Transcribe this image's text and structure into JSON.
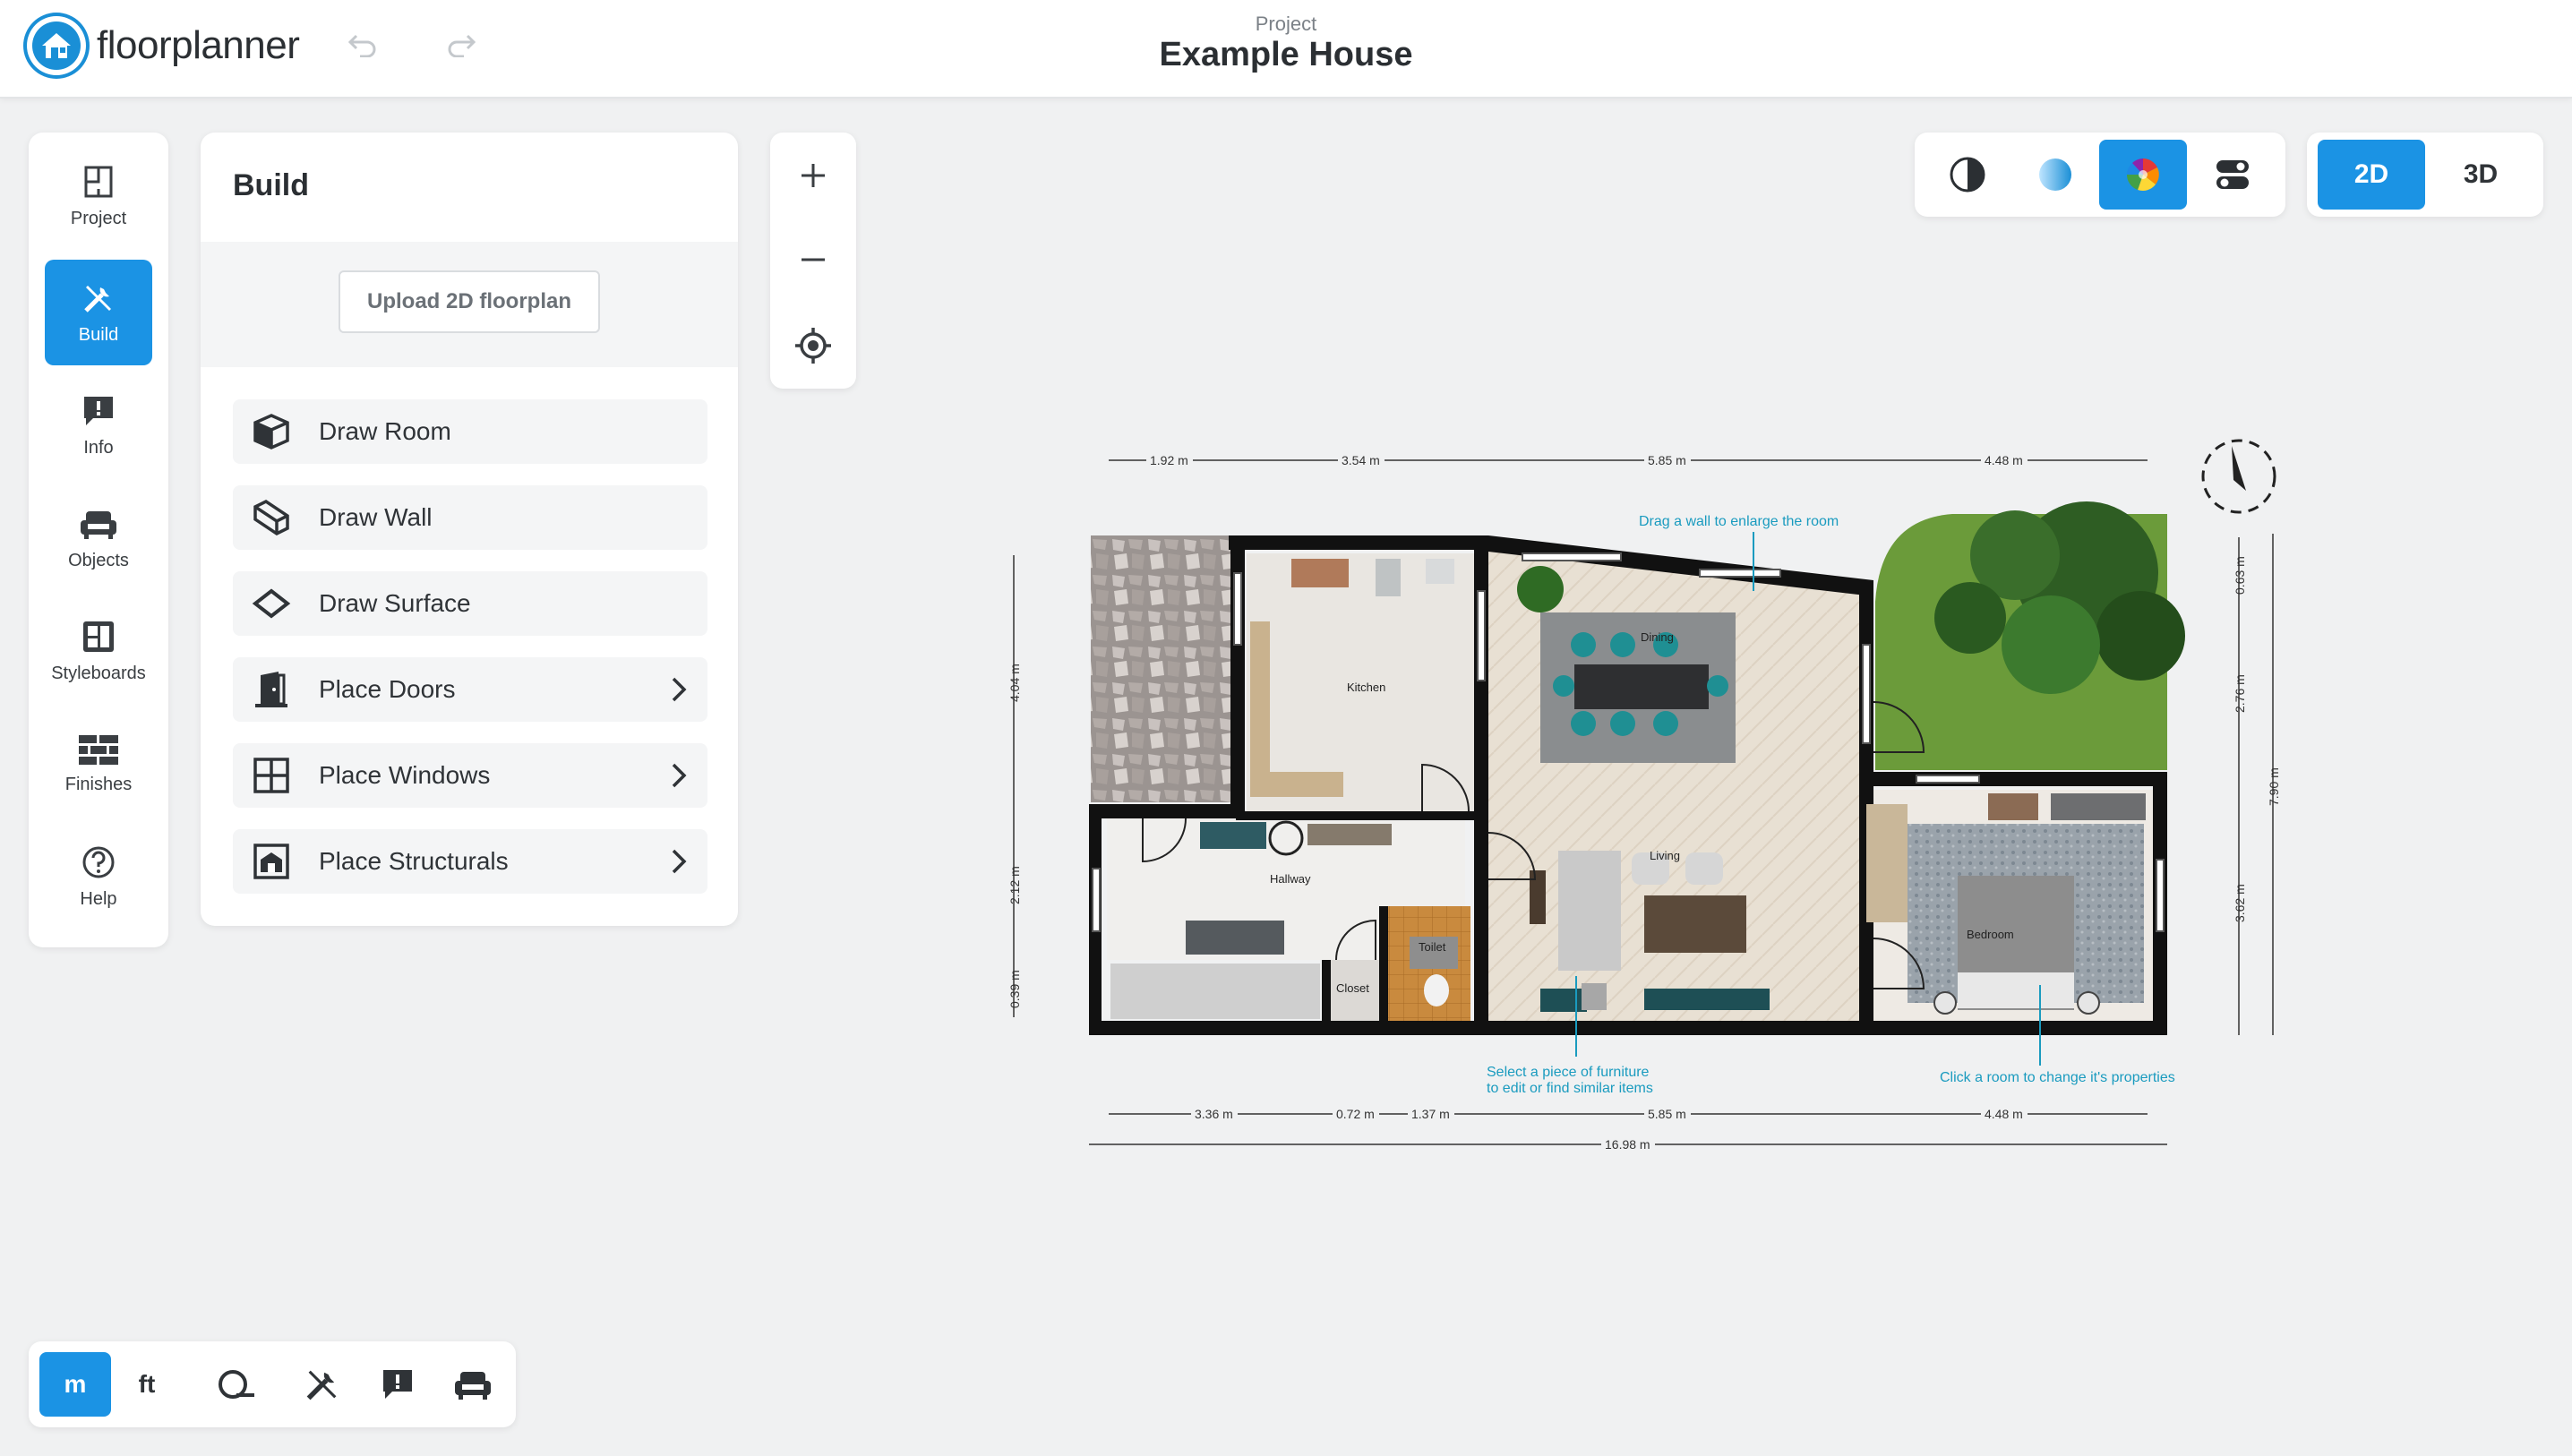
{
  "app": {
    "logo_text": "floorplanner",
    "project_label": "Project",
    "project_title": "Example House"
  },
  "nav": [
    {
      "id": "project",
      "label": "Project",
      "icon": "project-icon"
    },
    {
      "id": "build",
      "label": "Build",
      "icon": "tools-icon",
      "active": true
    },
    {
      "id": "info",
      "label": "Info",
      "icon": "info-icon"
    },
    {
      "id": "objects",
      "label": "Objects",
      "icon": "sofa-icon"
    },
    {
      "id": "styleboards",
      "label": "Styleboards",
      "icon": "styleboard-icon"
    },
    {
      "id": "finishes",
      "label": "Finishes",
      "icon": "brick-icon"
    },
    {
      "id": "help",
      "label": "Help",
      "icon": "help-icon"
    }
  ],
  "build": {
    "title": "Build",
    "upload_label": "Upload 2D floorplan",
    "tools": [
      {
        "label": "Draw Room",
        "icon": "cube-icon",
        "submenu": false
      },
      {
        "label": "Draw Wall",
        "icon": "wall-icon",
        "submenu": false
      },
      {
        "label": "Draw Surface",
        "icon": "surface-icon",
        "submenu": false
      },
      {
        "label": "Place Doors",
        "icon": "door-icon",
        "submenu": true
      },
      {
        "label": "Place Windows",
        "icon": "window-icon",
        "submenu": true
      },
      {
        "label": "Place Structurals",
        "icon": "structural-icon",
        "submenu": true
      }
    ]
  },
  "view_modes": {
    "two_d": "2D",
    "three_d": "3D",
    "active": "2D"
  },
  "render_styles": [
    "contrast-icon",
    "blueprint-icon",
    "color-icon",
    "toggle-settings-icon"
  ],
  "units": {
    "metric": "m",
    "imperial": "ft",
    "active": "m"
  },
  "plan": {
    "rooms": {
      "kitchen": "Kitchen",
      "dining": "Dining",
      "living": "Living",
      "hallway": "Hallway",
      "toilet": "Toilet",
      "closet": "Closet",
      "bedroom": "Bedroom"
    },
    "dims_top": [
      "1.92 m",
      "3.54 m",
      "5.85 m",
      "4.48 m"
    ],
    "dims_bottom": [
      "3.36 m",
      "0.72 m",
      "1.37 m",
      "5.85 m",
      "4.48 m"
    ],
    "dim_total": "16.98 m",
    "dims_left": [
      "4.04 m",
      "2.12 m",
      "0.39 m"
    ],
    "dims_right": [
      "0.63 m",
      "2.76 m",
      "3.62 m",
      "7.90 m"
    ],
    "tips": {
      "wall": "Drag a wall to enlarge the room",
      "furniture_1": "Select a piece of furniture",
      "furniture_2": "to edit or find similar items",
      "room": "Click a room to change it's properties"
    }
  },
  "colors": {
    "accent": "#1b93e4",
    "tip": "#1a9bbf",
    "wall": "#111111"
  }
}
